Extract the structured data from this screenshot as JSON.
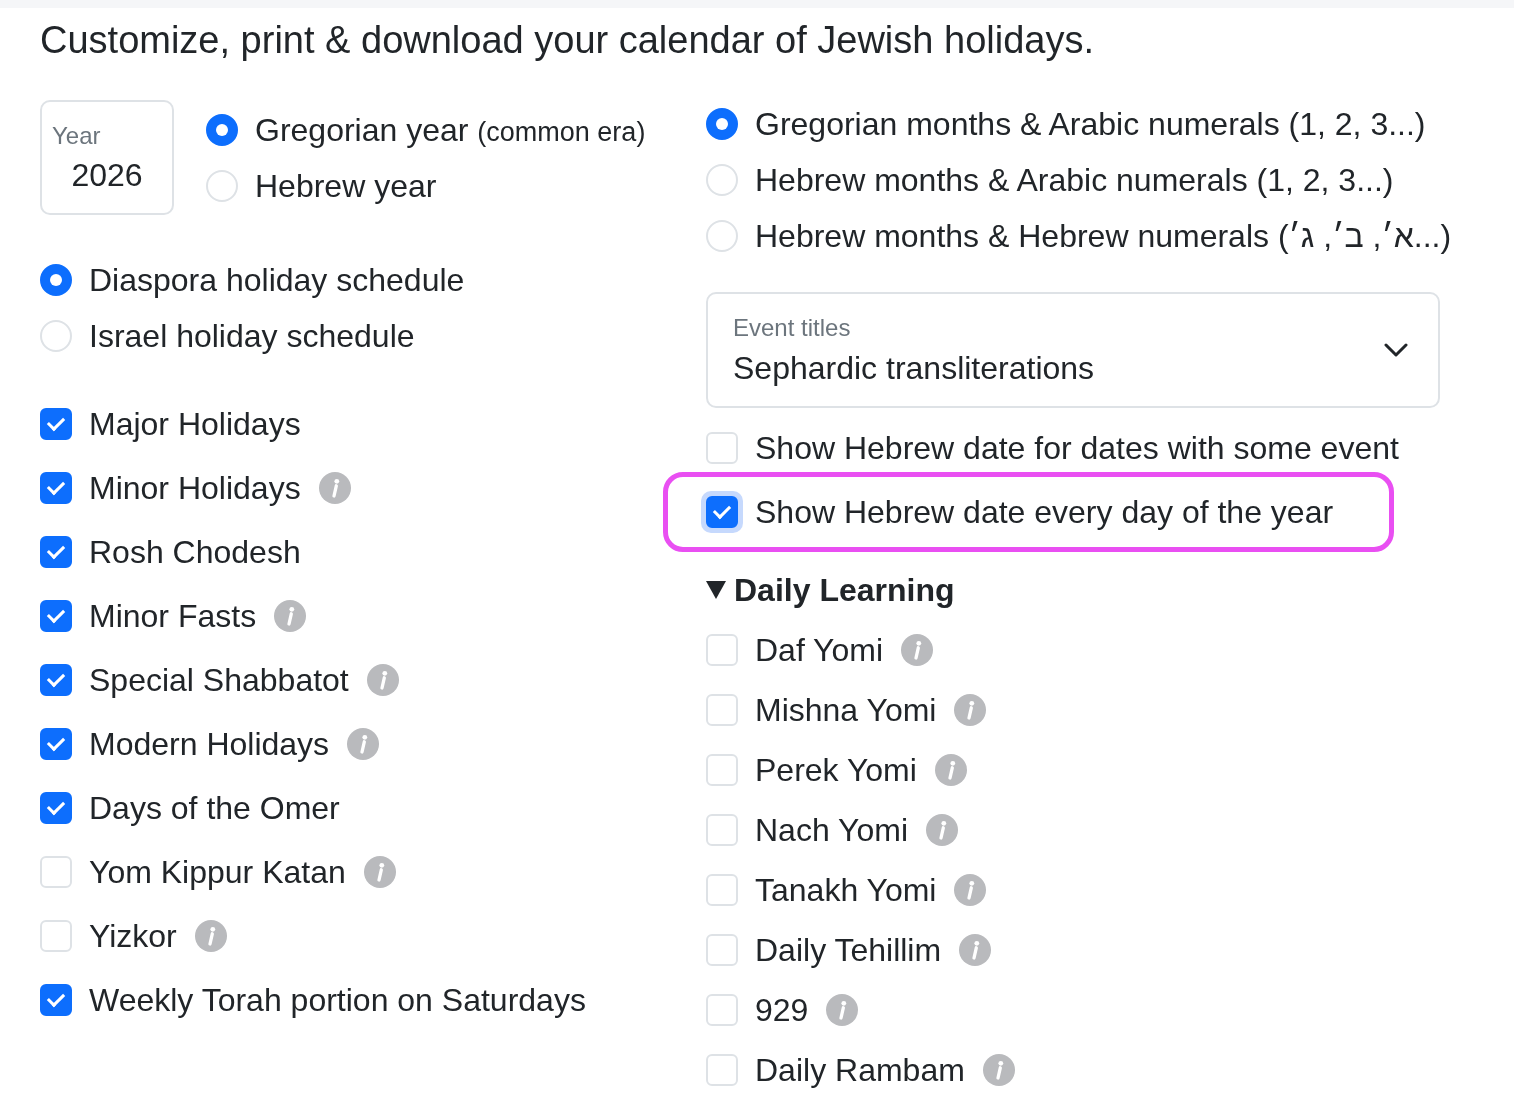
{
  "heading": "Customize, print & download your calendar of Jewish holidays.",
  "year_field": {
    "label": "Year",
    "value": "2026"
  },
  "year_type": [
    {
      "label": "Gregorian year",
      "note": "(common era)",
      "selected": true
    },
    {
      "label": "Hebrew year",
      "selected": false
    }
  ],
  "schedule": [
    {
      "label": "Diaspora holiday schedule",
      "selected": true
    },
    {
      "label": "Israel holiday schedule",
      "selected": false
    }
  ],
  "holidays": [
    {
      "label": "Major Holidays",
      "checked": true,
      "info": false
    },
    {
      "label": "Minor Holidays",
      "checked": true,
      "info": true
    },
    {
      "label": "Rosh Chodesh",
      "checked": true,
      "info": false
    },
    {
      "label": "Minor Fasts",
      "checked": true,
      "info": true
    },
    {
      "label": "Special Shabbatot",
      "checked": true,
      "info": true
    },
    {
      "label": "Modern Holidays",
      "checked": true,
      "info": true
    },
    {
      "label": "Days of the Omer",
      "checked": true,
      "info": false
    },
    {
      "label": "Yom Kippur Katan",
      "checked": false,
      "info": true
    },
    {
      "label": "Yizkor",
      "checked": false,
      "info": true
    },
    {
      "label": "Weekly Torah portion on Saturdays",
      "checked": true,
      "info": false
    }
  ],
  "date_format": [
    {
      "label": "Gregorian months & Arabic numerals (1, 2, 3...)",
      "selected": true
    },
    {
      "label": "Hebrew months & Arabic numerals (1, 2, 3...)",
      "selected": false
    },
    {
      "label": "Hebrew months & Hebrew numerals (א׳, ב׳, ג׳...)",
      "selected": false
    }
  ],
  "event_titles": {
    "label": "Event titles",
    "value": "Sephardic transliterations"
  },
  "hebrew_date": [
    {
      "label": "Show Hebrew date for dates with some event",
      "checked": false,
      "focused": false,
      "highlighted": false
    },
    {
      "label": "Show Hebrew date every day of the year",
      "checked": true,
      "focused": true,
      "highlighted": true
    }
  ],
  "daily_learning": {
    "title": "Daily Learning",
    "expanded": true,
    "items": [
      {
        "label": "Daf Yomi",
        "checked": false,
        "info": true
      },
      {
        "label": "Mishna Yomi",
        "checked": false,
        "info": true
      },
      {
        "label": "Perek Yomi",
        "checked": false,
        "info": true
      },
      {
        "label": "Nach Yomi",
        "checked": false,
        "info": true
      },
      {
        "label": "Tanakh Yomi",
        "checked": false,
        "info": true
      },
      {
        "label": "Daily Tehillim",
        "checked": false,
        "info": true
      },
      {
        "label": "929",
        "checked": false,
        "info": true
      },
      {
        "label": "Daily Rambam",
        "checked": false,
        "info": true
      }
    ]
  }
}
